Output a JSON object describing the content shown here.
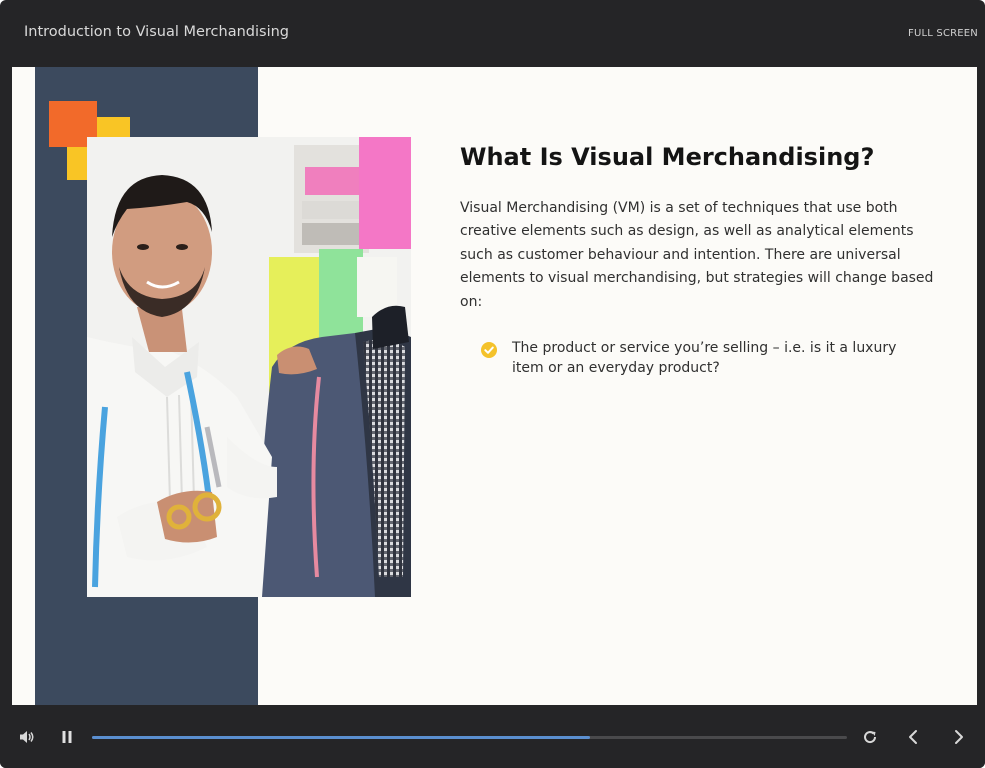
{
  "header": {
    "title": "Introduction to Visual Merchandising",
    "fullscreen_label": "FULL SCREEN"
  },
  "slide": {
    "heading": "What Is Visual Merchandising?",
    "body": "Visual Merchandising (VM) is a set of techniques that use both creative elements such as design, as well as analytical elements such as customer behaviour and intention. There are universal elements to visual merchandising, but strategies will change based on:",
    "bullets": [
      "The product or service you’re selling – i.e. is it a luxury item or an everyday product?"
    ],
    "accent_colors": {
      "navy": "#3c4a5e",
      "orange": "#f26a2a",
      "yellow": "#f9c525",
      "check": "#f4c22b"
    }
  },
  "controls": {
    "progress": 0.66,
    "progress_color": "#5b8fd0",
    "icons": [
      "volume-icon",
      "pause-icon",
      "replay-icon",
      "previous-icon",
      "next-icon"
    ]
  }
}
